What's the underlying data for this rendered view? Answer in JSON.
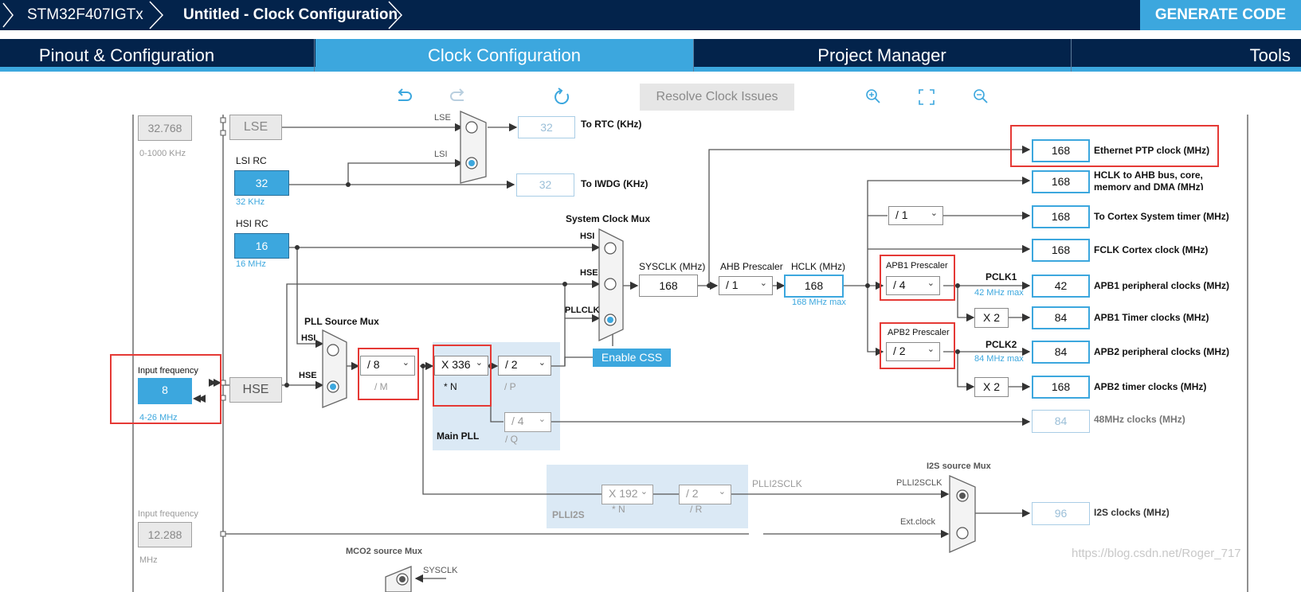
{
  "breadcrumb": {
    "device": "STM32F407IGTx",
    "project": "Untitled - Clock Configuration"
  },
  "header": {
    "generate_label": "GENERATE CODE"
  },
  "tabs": [
    {
      "label": "Pinout & Configuration"
    },
    {
      "label": "Clock Configuration"
    },
    {
      "label": "Project Manager"
    },
    {
      "label": "Tools"
    }
  ],
  "toolbar": {
    "resolve_label": "Resolve Clock Issues",
    "undo_icon": "undo-icon",
    "redo_icon": "redo-icon",
    "reset_icon": "refresh-icon",
    "zoom_in_icon": "zoom-in-icon",
    "fit_icon": "fit-screen-icon",
    "zoom_out_icon": "zoom-out-icon"
  },
  "colors": {
    "navy": "#03234b",
    "accent": "#3ca7de",
    "highlight": "#e53935"
  },
  "clock": {
    "lse_value": "32.768",
    "lse_range": "0-1000 KHz",
    "lse_label": "LSE",
    "lsi_title": "LSI RC",
    "lsi_value": "32",
    "lsi_unit": "32 KHz",
    "hsi_title": "HSI RC",
    "hsi_value": "16",
    "hsi_unit": "16 MHz",
    "input_freq_label": "Input frequency",
    "hse_value": "8",
    "hse_range": "4-26 MHz",
    "hse_label": "HSE",
    "i2s_input_label": "Input frequency",
    "i2s_input_value": "12.288",
    "i2s_input_unit": "MHz",
    "rtc_mux_lse": "LSE",
    "rtc_mux_lsi": "LSI",
    "rtc_value": "32",
    "rtc_label": "To RTC (KHz)",
    "iwdg_value": "32",
    "iwdg_label": "To IWDG (KHz)",
    "pll_src_mux": "PLL Source Mux",
    "pll_src_hsi": "HSI",
    "pll_src_hse": "HSE",
    "pllm": "/ 8",
    "pllm_label": "/ M",
    "plln": "X 336",
    "plln_label": "* N",
    "pllp": "/ 2",
    "pllp_label": "/ P",
    "pllq": "/ 4",
    "pllq_label": "/ Q",
    "main_pll": "Main PLL",
    "sys_mux_title": "System Clock Mux",
    "sys_hsi": "HSI",
    "sys_hse": "HSE",
    "sys_pll": "PLLCLK",
    "enable_css": "Enable CSS",
    "sysclk_label": "SYSCLK (MHz)",
    "sysclk_value": "168",
    "ahb_label": "AHB Prescaler",
    "ahb_value": "/ 1",
    "hclk_label": "HCLK (MHz)",
    "hclk_value": "168",
    "hclk_max": "168 MHz max",
    "cortex_div": "/ 1",
    "apb1_label": "APB1 Prescaler",
    "apb1_value": "/ 4",
    "pclk1_label": "PCLK1",
    "pclk1_max": "42 MHz max",
    "apb2_label": "APB2 Prescaler",
    "apb2_value": "/ 2",
    "pclk2_label": "PCLK2",
    "pclk2_max": "84 MHz max",
    "x2_a": "X 2",
    "x2_b": "X 2",
    "outputs": [
      {
        "value": "168",
        "label": "Ethernet PTP clock (MHz)"
      },
      {
        "value": "168",
        "label": "HCLK to AHB bus, core,",
        "label2": "memory and DMA (MHz)"
      },
      {
        "value": "168",
        "label": "To Cortex System timer (MHz)"
      },
      {
        "value": "168",
        "label": "FCLK Cortex clock (MHz)"
      },
      {
        "value": "42",
        "label": "APB1 peripheral clocks (MHz)"
      },
      {
        "value": "84",
        "label": "APB1 Timer clocks (MHz)"
      },
      {
        "value": "84",
        "label": "APB2 peripheral clocks (MHz)"
      },
      {
        "value": "168",
        "label": "APB2 timer clocks (MHz)"
      },
      {
        "value": "84",
        "label": "48MHz clocks (MHz)"
      },
      {
        "value": "96",
        "label": "I2S clocks (MHz)"
      }
    ],
    "plli2s_n": "X 192",
    "plli2s_n_label": "* N",
    "plli2s_r": "/ 2",
    "plli2s_r_label": "/ R",
    "plli2s_title": "PLLI2S",
    "plli2sclk": "PLLI2SCLK",
    "i2s_mux_title": "I2S source Mux",
    "i2s_mux_plli2s": "PLLI2SCLK",
    "i2s_mux_ext": "Ext.clock",
    "mco2_title": "MCO2 source Mux",
    "mco2_sysclk": "SYSCLK"
  },
  "watermark": "https://blog.csdn.net/Roger_717"
}
